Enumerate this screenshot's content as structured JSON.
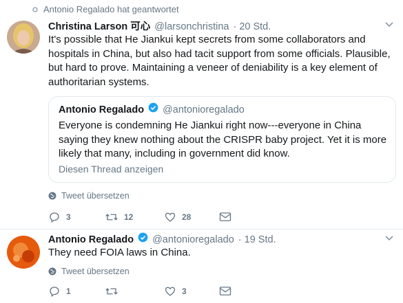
{
  "context": {
    "replied_text": "Antonio Regalado hat geantwortet"
  },
  "tweet1": {
    "name": "Christina Larson 可心",
    "handle": "@larsonchristina",
    "time": "· 20 Std.",
    "text": "It's possible that He Jiankui kept secrets from some collaborators and hospitals in China, but also had tacit support from some officials. Plausible, but hard to prove. Maintaining a veneer of deniability is a key element of authoritarian systems.",
    "quote": {
      "name": "Antonio Regalado",
      "handle": "@antonioregalado",
      "text": "Everyone is condemning He Jiankui right now---everyone in China saying they knew nothing about the CRISPR baby project. Yet it is more likely that many, including in government did know.",
      "thread_link": "Diesen Thread anzeigen"
    },
    "translate": "Tweet übersetzen",
    "stats": {
      "replies": "3",
      "retweets": "12",
      "likes": "28"
    }
  },
  "tweet2": {
    "name": "Antonio Regalado",
    "handle": "@antonioregalado",
    "time": "· 19 Std.",
    "text": "They need FOIA laws in China.",
    "translate": "Tweet übersetzen",
    "stats": {
      "replies": "1",
      "retweets": "",
      "likes": "3"
    }
  },
  "colors": {
    "verified": "#1da1f2",
    "muted": "#657786",
    "text": "#14171a",
    "border": "#e1e8ed"
  }
}
